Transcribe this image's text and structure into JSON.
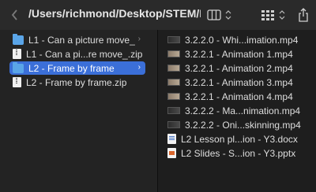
{
  "toolbar": {
    "path_title": "/Users/richmond/Desktop/STEM/L...",
    "back_icon": "chevron-left-icon",
    "view_icon": "column-view-icon",
    "group_icon": "grid-view-icon",
    "share_icon": "share-icon"
  },
  "column1": {
    "items": [
      {
        "label": "L1 - Can a picture move_",
        "icon": "folder-icon",
        "has_chevron": true
      },
      {
        "label": "L1 - Can a pi...re move_.zip",
        "icon": "zip-icon"
      },
      {
        "label": "L2 - Frame by frame",
        "icon": "folder-icon",
        "selected": true,
        "has_chevron": true
      },
      {
        "label": "L2 - Frame by frame.zip",
        "icon": "zip-icon"
      }
    ]
  },
  "column2": {
    "items": [
      {
        "label": "3.2.2.0 - Whi...imation.mp4",
        "icon": "video-dark-icon"
      },
      {
        "label": "3.2.2.1 - Animation 1.mp4",
        "icon": "video-icon"
      },
      {
        "label": "3.2.2.1 - Animation 2.mp4",
        "icon": "video-icon"
      },
      {
        "label": "3.2.2.1 - Animation 3.mp4",
        "icon": "video-icon"
      },
      {
        "label": "3.2.2.1 - Animation 4.mp4",
        "icon": "video-icon"
      },
      {
        "label": "3.2.2.2 - Ma...nimation.mp4",
        "icon": "video-dark-icon"
      },
      {
        "label": "3.2.2.2 - Oni...skinning.mp4",
        "icon": "video-dark-icon"
      },
      {
        "label": "L2 Lesson pl...ion - Y3.docx",
        "icon": "docx-icon"
      },
      {
        "label": "L2 Slides - S...ion - Y3.pptx",
        "icon": "pptx-icon"
      }
    ]
  },
  "chevron_glyph": "›",
  "colors": {
    "selection": "#3b6fd8",
    "folder": "#5aa5e8"
  }
}
